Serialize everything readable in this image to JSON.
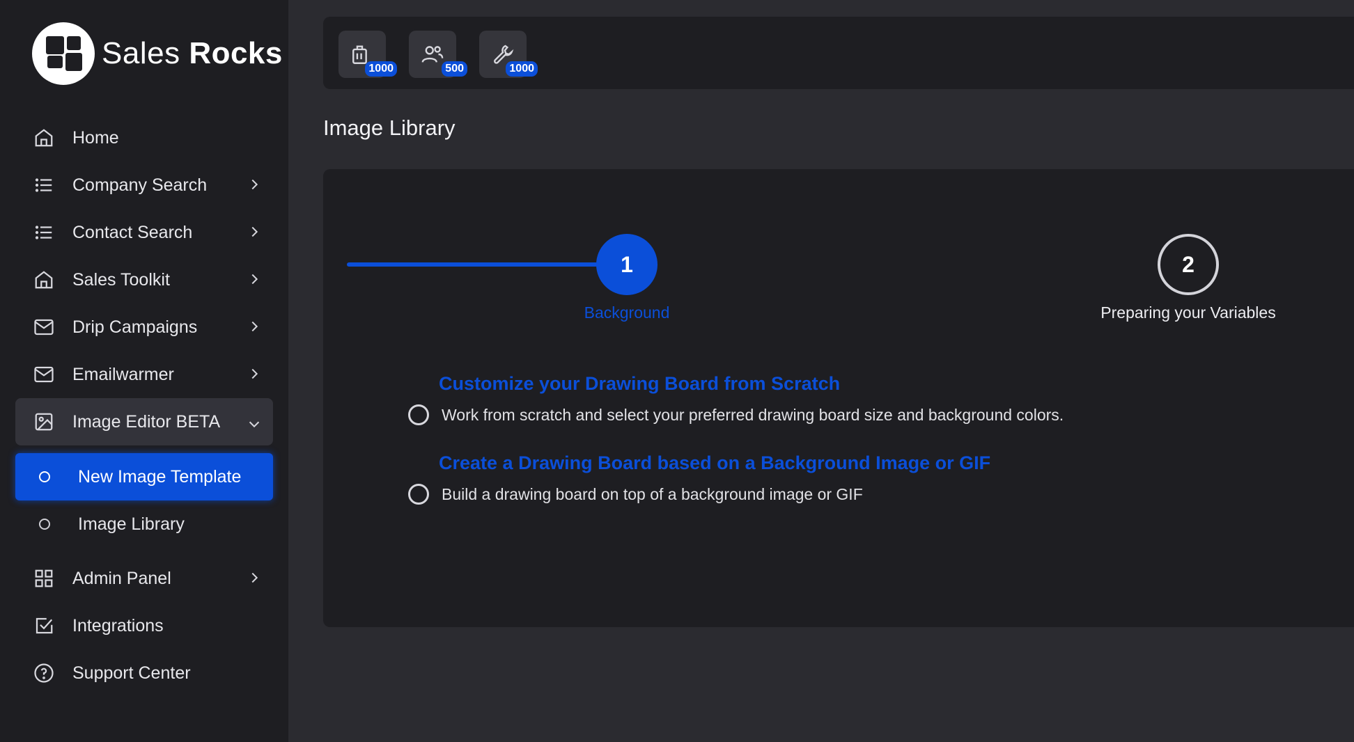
{
  "brand": {
    "name_light": "Sales",
    "name_bold": "Rocks"
  },
  "sidebar": {
    "items": [
      {
        "label": "Home",
        "icon": "home-icon",
        "has_chevron": false
      },
      {
        "label": "Company Search",
        "icon": "list-icon",
        "has_chevron": true
      },
      {
        "label": "Contact Search",
        "icon": "list-icon",
        "has_chevron": true
      },
      {
        "label": "Sales Toolkit",
        "icon": "home-icon",
        "has_chevron": true
      },
      {
        "label": "Drip Campaigns",
        "icon": "mail-icon",
        "has_chevron": true
      },
      {
        "label": "Emailwarmer",
        "icon": "mail-icon",
        "has_chevron": true
      },
      {
        "label": "Image Editor BETA",
        "icon": "image-icon",
        "expanded": true
      },
      {
        "label": "Admin Panel",
        "icon": "grid-icon",
        "has_chevron": true
      },
      {
        "label": "Integrations",
        "icon": "checkbox-icon",
        "has_chevron": false
      },
      {
        "label": "Support Center",
        "icon": "help-circle-icon",
        "has_chevron": false
      }
    ],
    "subitems": [
      {
        "label": "New Image Template",
        "active": true
      },
      {
        "label": "Image Library",
        "active": false
      }
    ]
  },
  "credits": [
    {
      "icon": "briefcase-icon",
      "count": "1000"
    },
    {
      "icon": "users-icon",
      "count": "500"
    },
    {
      "icon": "wrench-icon",
      "count": "1000"
    }
  ],
  "page": {
    "title": "Image Library"
  },
  "stepper": {
    "steps": [
      {
        "number": "1",
        "label": "Background",
        "state": "active"
      },
      {
        "number": "2",
        "label": "Preparing your Variables",
        "state": "todo"
      }
    ]
  },
  "options": [
    {
      "title": "Customize your Drawing Board from Scratch",
      "description": "Work from scratch and select your preferred drawing board size and background colors."
    },
    {
      "title": "Create a Drawing Board based on a Background Image or GIF",
      "description": "Build a drawing board on top of a background image or GIF"
    }
  ],
  "colors": {
    "accent": "#0b4fd9",
    "sidebar_bg": "#1e1e22",
    "page_bg": "#2b2b30"
  }
}
